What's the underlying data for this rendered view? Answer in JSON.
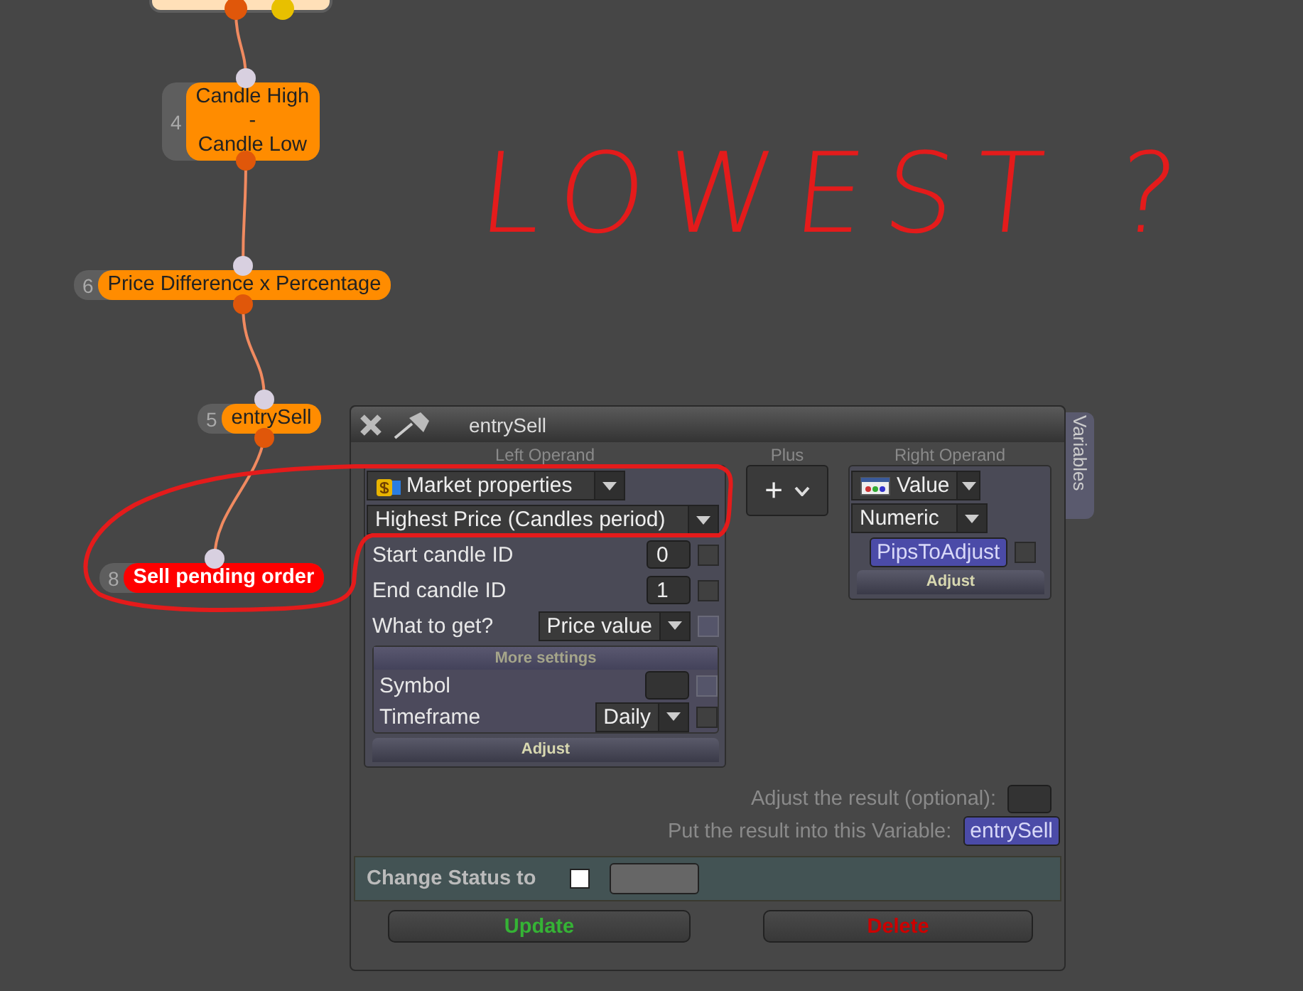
{
  "nodes": [
    {
      "number": "4",
      "lines": [
        "Candle High",
        "-",
        "Candle Low"
      ],
      "kind": "operation"
    },
    {
      "number": "6",
      "lines": [
        "Price Difference x Percentage"
      ],
      "kind": "operation"
    },
    {
      "number": "5",
      "lines": [
        "entrySell"
      ],
      "kind": "operation"
    },
    {
      "number": "8",
      "lines": [
        "Sell pending order"
      ],
      "kind": "action"
    }
  ],
  "annotation": {
    "text": "LOWEST ?"
  },
  "dialog": {
    "title": "entrySell",
    "side_tab": "Variables",
    "left_operand": {
      "heading": "Left Operand",
      "source": "Market properties",
      "property": "Highest Price (Candles period)",
      "fields": [
        {
          "label": "Start candle ID",
          "kind": "input",
          "value": "0",
          "checkbox": {
            "checked": false,
            "disabled": false
          }
        },
        {
          "label": "End candle ID",
          "kind": "input",
          "value": "1",
          "checkbox": {
            "checked": false,
            "disabled": false
          }
        },
        {
          "label": "What to get?",
          "kind": "dropdown",
          "value": "Price value",
          "checkbox": {
            "checked": false,
            "disabled": true
          }
        }
      ],
      "more_settings": {
        "heading": "More settings",
        "fields": [
          {
            "label": "Symbol",
            "kind": "input",
            "checkbox": {
              "checked": false,
              "disabled": true
            }
          },
          {
            "label": "Timeframe",
            "kind": "dropdown",
            "value": "Daily",
            "checkbox": {
              "checked": false,
              "disabled": false
            }
          }
        ]
      },
      "adjust": "Adjust"
    },
    "operator": {
      "heading": "Plus",
      "symbol": "+"
    },
    "right_operand": {
      "heading": "Right Operand",
      "source": "Value",
      "type": "Numeric",
      "variable": "PipsToAdjust",
      "checkbox": {
        "checked": false,
        "disabled": false
      },
      "adjust": "Adjust"
    },
    "adjust_result": {
      "label": "Adjust the result (optional):"
    },
    "result_variable": {
      "label": "Put the result into this Variable:",
      "value": "entrySell"
    },
    "status": {
      "label": "Change Status to",
      "checked": false
    },
    "buttons": [
      {
        "label": "Update",
        "kind": "update"
      },
      {
        "label": "Delete",
        "kind": "delete"
      }
    ]
  }
}
